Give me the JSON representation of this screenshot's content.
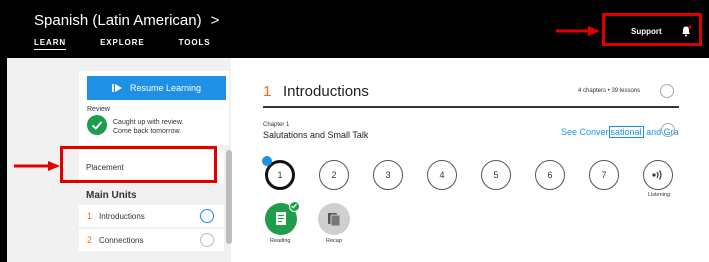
{
  "header": {
    "course_title": "Spanish (Latin American)",
    "course_chevron": ">",
    "nav": [
      "LEARN",
      "EXPLORE",
      "TOOLS"
    ],
    "support_label": "Support"
  },
  "sidebar": {
    "resume_label": "Resume Learning",
    "review_label": "Review",
    "review_status_line1": "Caught up with review.",
    "review_status_line2": "Come back tomorrow.",
    "placement_label": "Placement",
    "main_units_label": "Main Units",
    "units": [
      {
        "num": "1",
        "label": "Introductions"
      },
      {
        "num": "2",
        "label": "Connections"
      }
    ]
  },
  "main": {
    "unit_num": "1",
    "unit_title": "Introductions",
    "meta": "4 chapters • 39 lessons",
    "chapter_label": "Chapter 1",
    "chapter_title": "Salutations and Small Talk",
    "see_link_pre": "See Conver",
    "see_link_highlight": "sational",
    "see_link_post": " and Gra",
    "lessons": [
      "1",
      "2",
      "3",
      "4",
      "5",
      "6",
      "7"
    ],
    "listening_label": "Listening",
    "reading_label": "Reading",
    "recap_label": "Recap"
  },
  "colors": {
    "accent_blue": "#1e90e6",
    "accent_orange": "#ff6a00",
    "success_green": "#1f9d4c",
    "annotation_red": "#e00000"
  }
}
